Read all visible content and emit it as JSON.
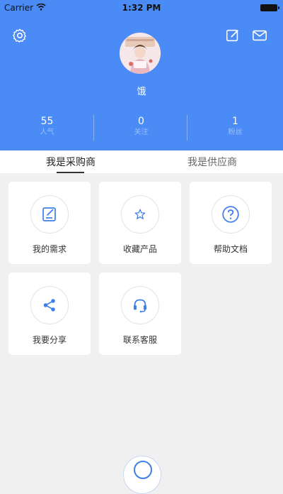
{
  "status_bar": {
    "carrier": "Carrier",
    "time": "1:32 PM"
  },
  "header": {
    "username": "饿",
    "stats": [
      {
        "value": "55",
        "label": "人气"
      },
      {
        "value": "0",
        "label": "关注"
      },
      {
        "value": "1",
        "label": "粉丝"
      }
    ]
  },
  "tabs": [
    {
      "label": "我是采购商",
      "active": true
    },
    {
      "label": "我是供应商",
      "active": false
    }
  ],
  "grid": {
    "items": [
      {
        "label": "我的需求",
        "icon": "edit-doc-icon"
      },
      {
        "label": "收藏产品",
        "icon": "star-icon"
      },
      {
        "label": "帮助文档",
        "icon": "help-icon"
      },
      {
        "label": "我要分享",
        "icon": "share-icon"
      },
      {
        "label": "联系客服",
        "icon": "headset-icon"
      }
    ]
  },
  "colors": {
    "primary": "#4a8bf5",
    "icon_blue": "#3f7fe8",
    "background": "#f0f0f0"
  }
}
